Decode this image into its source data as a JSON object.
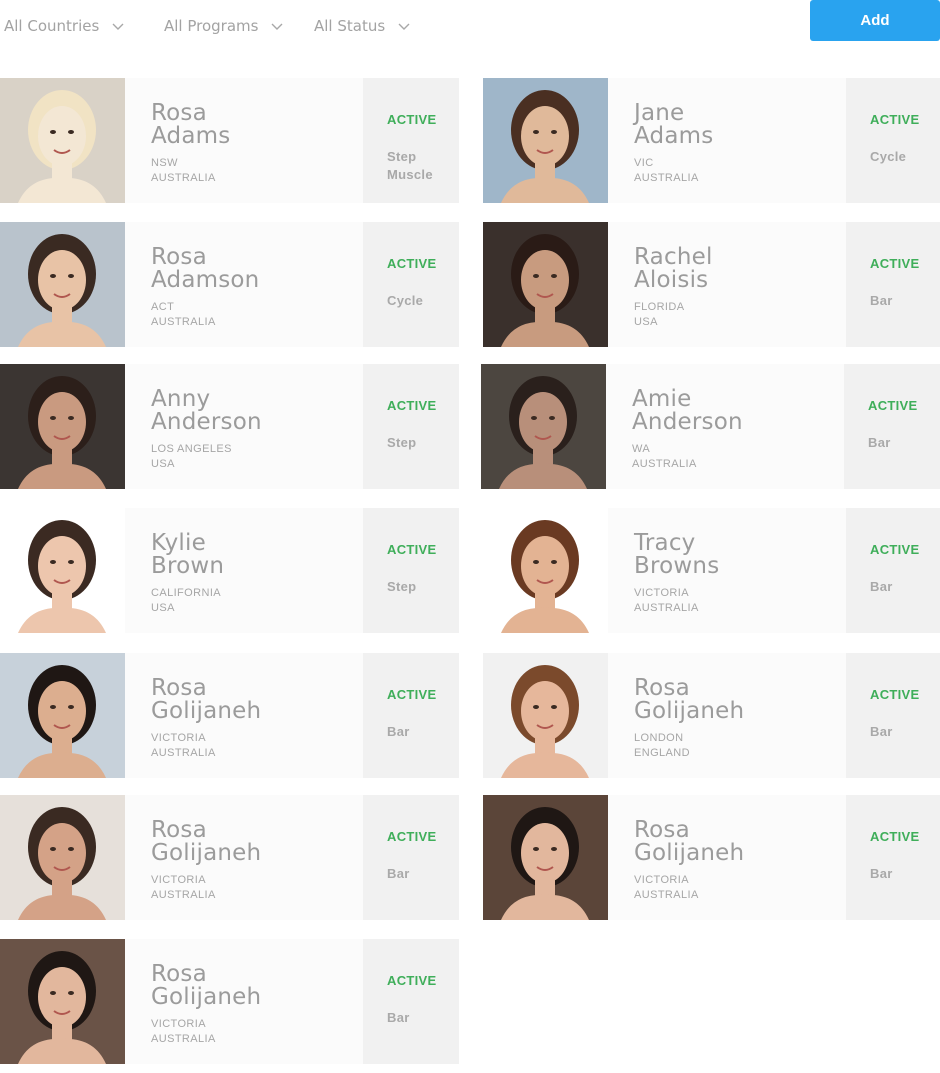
{
  "filters": {
    "countries": "All Countries",
    "programs": "All Programs",
    "status": "All Status"
  },
  "add_button": "Add",
  "colors": {
    "accent": "#29a3ef",
    "active_status": "#3fae5a",
    "card_info_bg": "#fbfbfb",
    "card_status_bg": "#f1f1f1"
  },
  "members": [
    {
      "first": "Rosa",
      "last": "Adams",
      "region": "NSW",
      "country": "Australia",
      "status": "ACTIVE",
      "programs": [
        "Step",
        "Muscle"
      ]
    },
    {
      "first": "Jane",
      "last": "Adams",
      "region": "VIC",
      "country": "Australia",
      "status": "ACTIVE",
      "programs": [
        "Cycle"
      ]
    },
    {
      "first": "Rosa",
      "last": "Adamson",
      "region": "ACT",
      "country": "Australia",
      "status": "ACTIVE",
      "programs": [
        "Cycle"
      ]
    },
    {
      "first": "Rachel",
      "last": "Aloisis",
      "region": "Florida",
      "country": "USA",
      "status": "ACTIVE",
      "programs": [
        "Bar"
      ]
    },
    {
      "first": "Anny",
      "last": "Anderson",
      "region": "Los Angeles",
      "country": "USA",
      "status": "ACTIVE",
      "programs": [
        "Step"
      ]
    },
    {
      "first": "Amie",
      "last": "Anderson",
      "region": "WA",
      "country": "Australia",
      "status": "ACTIVE",
      "programs": [
        "Bar"
      ]
    },
    {
      "first": "Kylie",
      "last": "Brown",
      "region": "California",
      "country": "USA",
      "status": "ACTIVE",
      "programs": [
        "Step"
      ]
    },
    {
      "first": "Tracy",
      "last": "Browns",
      "region": "Victoria",
      "country": "Australia",
      "status": "ACTIVE",
      "programs": [
        "Bar"
      ]
    },
    {
      "first": "Rosa",
      "last": "Golijaneh",
      "region": "Victoria",
      "country": "Australia",
      "status": "ACTIVE",
      "programs": [
        "Bar"
      ]
    },
    {
      "first": "Rosa",
      "last": "Golijaneh",
      "region": "London",
      "country": "England",
      "status": "ACTIVE",
      "programs": [
        "Bar"
      ]
    },
    {
      "first": "Rosa",
      "last": "Golijaneh",
      "region": "Victoria",
      "country": "Australia",
      "status": "ACTIVE",
      "programs": [
        "Bar"
      ]
    },
    {
      "first": "Rosa",
      "last": "Golijaneh",
      "region": "Victoria",
      "country": "Australia",
      "status": "ACTIVE",
      "programs": [
        "Bar"
      ]
    },
    {
      "first": "Rosa",
      "last": "Golijaneh",
      "region": "Victoria",
      "country": "Australia",
      "status": "ACTIVE",
      "programs": [
        "Bar"
      ]
    }
  ]
}
